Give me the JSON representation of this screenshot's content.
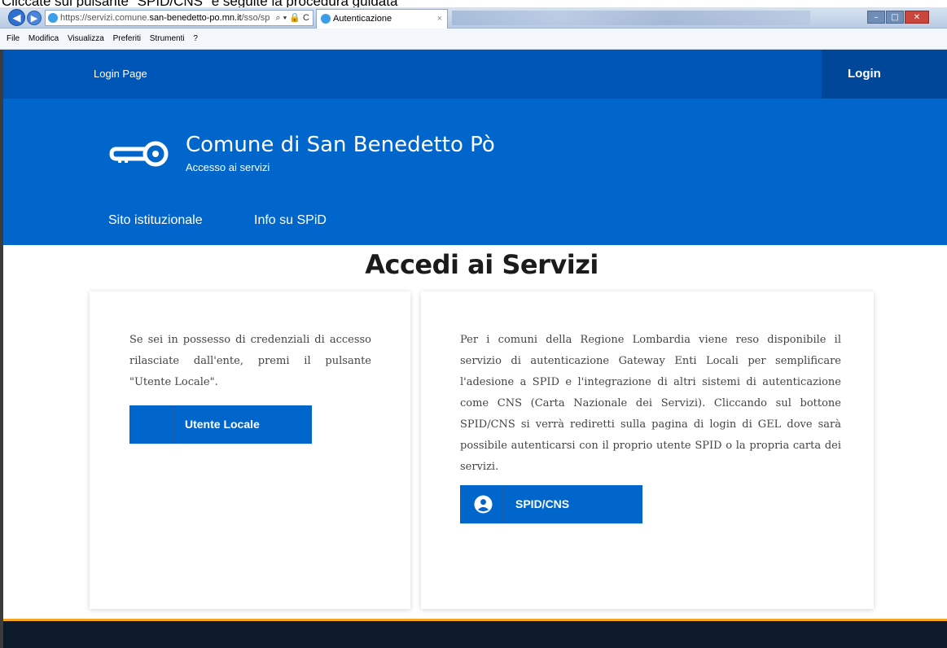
{
  "caption": "Cliccate sul pulsante \"SPID/CNS\" e seguite la procedura guidata",
  "browser": {
    "url_prefix": "https://servizi.comune.",
    "url_domain": "san-benedetto-po.mn.it",
    "url_path": "/sso/sp",
    "address_tools": "⌕ ▾ 🔒 C",
    "tab_title": "Autenticazione",
    "tab_close": "×",
    "menu": [
      "File",
      "Modifica",
      "Visualizza",
      "Preferiti",
      "Strumenti",
      "?"
    ]
  },
  "topbar": {
    "link": "Login Page",
    "login": "Login"
  },
  "header": {
    "title": "Comune di San Benedetto Pò",
    "subtitle": "Accesso ai servizi",
    "nav": [
      "Sito istituzionale",
      "Info su SPiD"
    ]
  },
  "main": {
    "heading": "Accedi ai Servizi",
    "local_card": {
      "text": "Se sei in possesso di credenziali di accesso rilasciate dall'ente, premi il pulsante \"Utente Locale\".",
      "button": "Utente Locale"
    },
    "spid_card": {
      "text": "Per i comuni della Regione Lombardia viene reso disponibile il servizio di autenticazione Gateway Enti Locali per semplificare l'adesione a SPID e l'integrazione di altri sistemi di autenticazione come CNS (Carta Nazionale dei Servizi). Cliccando sul bottone SPID/CNS si verrà rediretti sulla pagina di login di GEL dove sarà possibile autenticarsi con il proprio utente SPID o la propria carta dei servizi.",
      "button": "SPID/CNS"
    }
  },
  "icons": {
    "key": "key-icon",
    "spid": "user-icon"
  },
  "colors": {
    "topbar": "#0056b6",
    "header": "#0066cc",
    "login": "#00479a",
    "button": "#0066cc",
    "footer": "#0c1a2c",
    "footer_accent": "#f5a623"
  }
}
